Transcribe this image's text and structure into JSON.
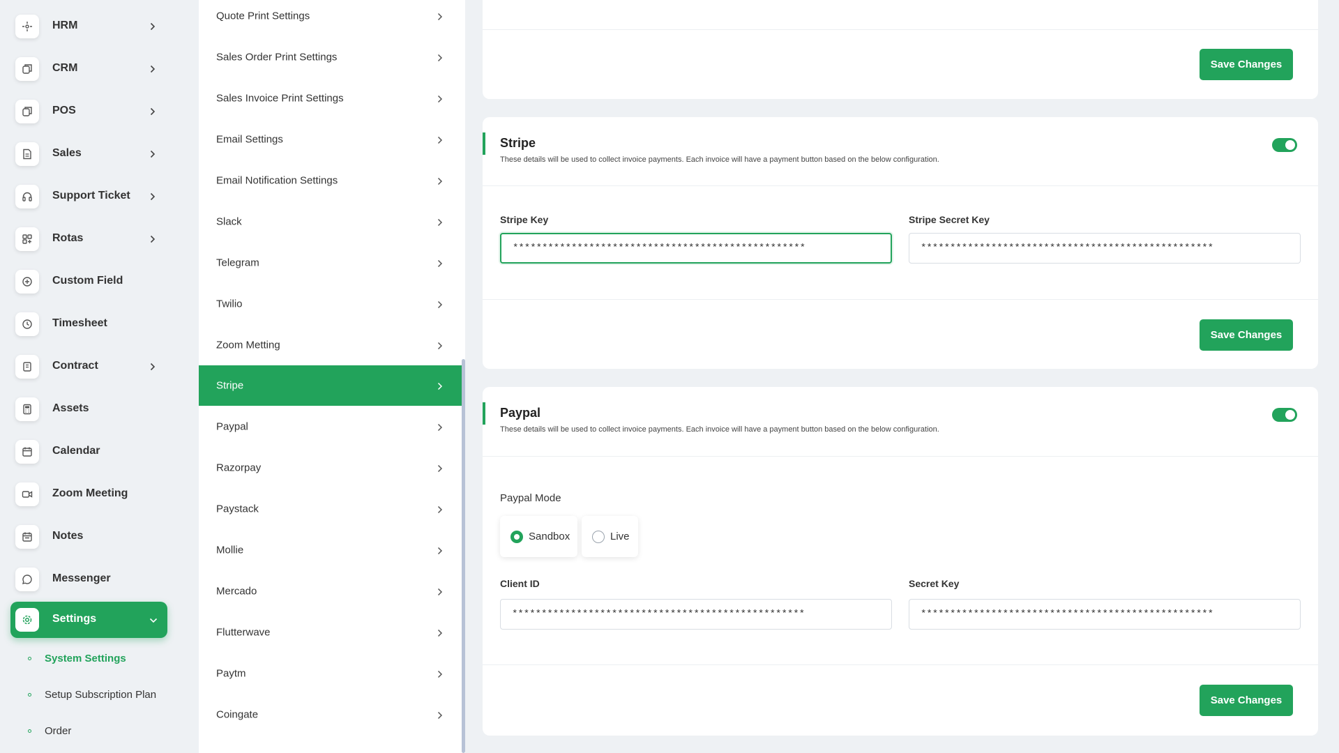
{
  "sidebar": {
    "items": [
      {
        "label": "HRM",
        "icon": "hrm-icon",
        "has_chevron": true
      },
      {
        "label": "CRM",
        "icon": "crm-icon",
        "has_chevron": true
      },
      {
        "label": "POS",
        "icon": "pos-icon",
        "has_chevron": true
      },
      {
        "label": "Sales",
        "icon": "sales-icon",
        "has_chevron": true
      },
      {
        "label": "Support Ticket",
        "icon": "headset-icon",
        "has_chevron": true
      },
      {
        "label": "Rotas",
        "icon": "grid-icon",
        "has_chevron": true
      },
      {
        "label": "Custom Field",
        "icon": "plus-circle-icon",
        "has_chevron": false
      },
      {
        "label": "Timesheet",
        "icon": "clock-icon",
        "has_chevron": false
      },
      {
        "label": "Contract",
        "icon": "contract-icon",
        "has_chevron": true
      },
      {
        "label": "Assets",
        "icon": "calculator-icon",
        "has_chevron": false
      },
      {
        "label": "Calendar",
        "icon": "calendar-icon",
        "has_chevron": false
      },
      {
        "label": "Zoom Meeting",
        "icon": "video-icon",
        "has_chevron": false
      },
      {
        "label": "Notes",
        "icon": "notes-icon",
        "has_chevron": false
      },
      {
        "label": "Messenger",
        "icon": "chat-icon",
        "has_chevron": false
      },
      {
        "label": "Settings",
        "icon": "gear-icon",
        "has_chevron": true,
        "active": true
      }
    ],
    "sub_items": [
      {
        "label": "System Settings",
        "current": true
      },
      {
        "label": "Setup Subscription Plan",
        "current": false
      },
      {
        "label": "Order",
        "current": false
      }
    ]
  },
  "settings_menu": {
    "items": [
      {
        "label": "Quote Print Settings"
      },
      {
        "label": "Sales Order Print Settings"
      },
      {
        "label": "Sales Invoice Print Settings"
      },
      {
        "label": "Email Settings"
      },
      {
        "label": "Email Notification Settings"
      },
      {
        "label": "Slack"
      },
      {
        "label": "Telegram"
      },
      {
        "label": "Twilio"
      },
      {
        "label": "Zoom Metting"
      },
      {
        "label": "Stripe",
        "active": true
      },
      {
        "label": "Paypal"
      },
      {
        "label": "Razorpay"
      },
      {
        "label": "Paystack"
      },
      {
        "label": "Mollie"
      },
      {
        "label": "Mercado"
      },
      {
        "label": "Flutterwave"
      },
      {
        "label": "Paytm"
      },
      {
        "label": "Coingate"
      }
    ]
  },
  "previous_card": {
    "save_label": "Save Changes"
  },
  "stripe": {
    "title": "Stripe",
    "description": "These details will be used to collect invoice payments. Each invoice will have a payment button based on the below configuration.",
    "enabled": true,
    "key_label": "Stripe Key",
    "key_value": "**************************************************",
    "secret_label": "Stripe Secret Key",
    "secret_value": "**************************************************",
    "save_label": "Save Changes"
  },
  "paypal": {
    "title": "Paypal",
    "description": "These details will be used to collect invoice payments. Each invoice will have a payment button based on the below configuration.",
    "enabled": true,
    "mode_label": "Paypal Mode",
    "mode_options": [
      {
        "label": "Sandbox",
        "checked": true
      },
      {
        "label": "Live",
        "checked": false
      }
    ],
    "client_id_label": "Client ID",
    "client_id_value": "**************************************************",
    "secret_label": "Secret Key",
    "secret_value": "**************************************************",
    "save_label": "Save Changes"
  },
  "colors": {
    "accent": "#22a35b",
    "background": "#eef1f4"
  }
}
